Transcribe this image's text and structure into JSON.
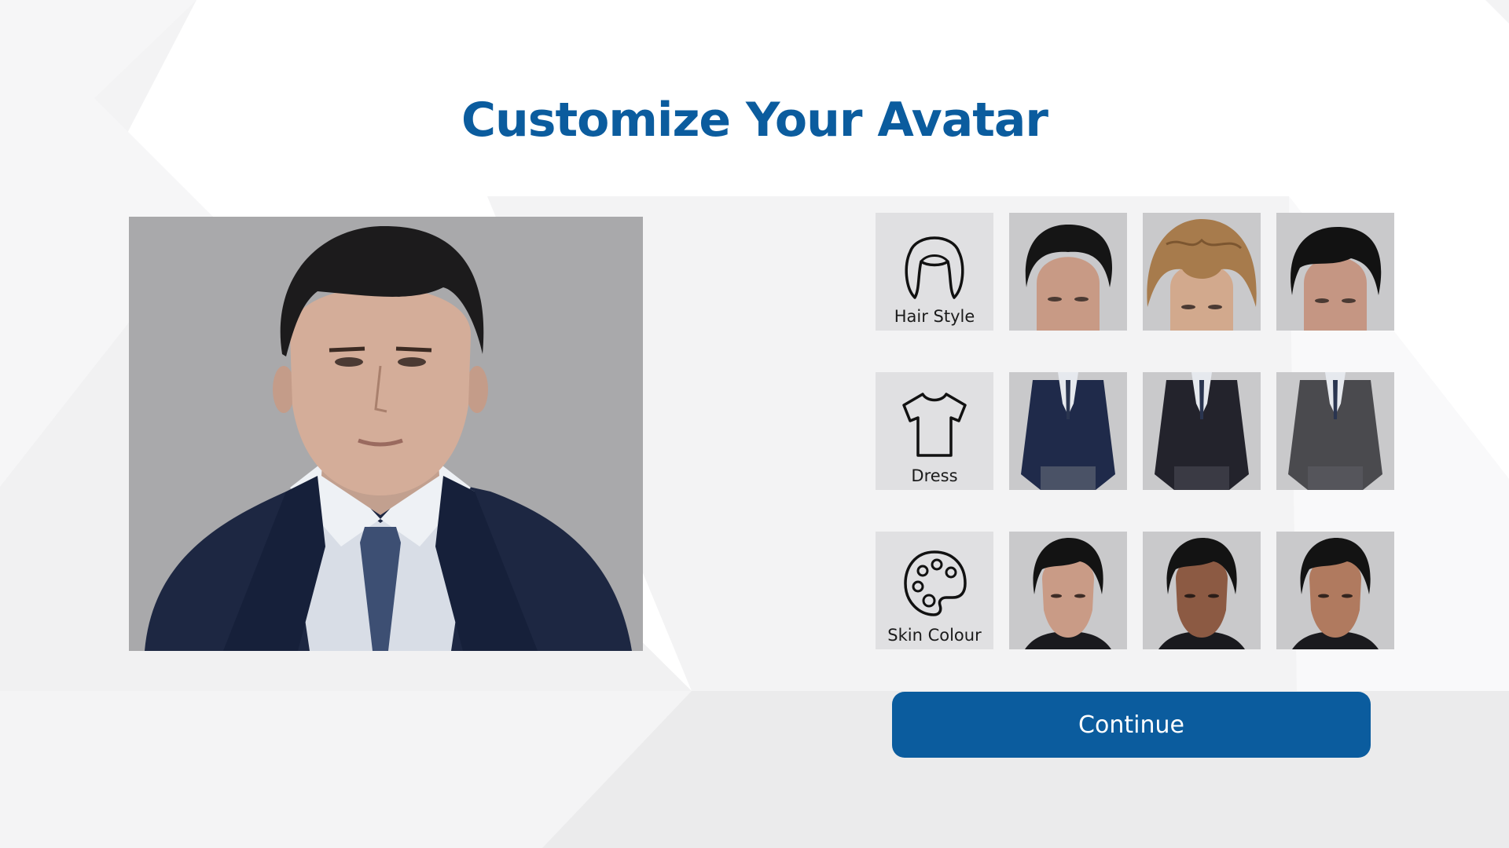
{
  "page": {
    "title": "Customize Your Avatar",
    "accent_color": "#0b5c9e",
    "background_color": "#f4f4f5"
  },
  "preview": {
    "background_color": "#a9a9ab",
    "hair_color": "#1c1b1c",
    "suit_color": "#1d2742",
    "shirt_color": "#d8dde6",
    "tie_color": "#3d4f73"
  },
  "categories": [
    {
      "label": "Hair Style",
      "icon": "hair-icon",
      "options": [
        {
          "hair_color": "#151515",
          "skin_color": "#c89a85",
          "type": "short-dark"
        },
        {
          "hair_color": "#a77b4c",
          "skin_color": "#d2a98d",
          "type": "wavy-blonde"
        },
        {
          "hair_color": "#121212",
          "skin_color": "#c59683",
          "type": "swept-dark"
        }
      ]
    },
    {
      "label": "Dress",
      "icon": "tshirt-icon",
      "options": [
        {
          "suit_color": "#1f2a4a",
          "type": "navy-suit"
        },
        {
          "suit_color": "#23232c",
          "type": "black-suit"
        },
        {
          "suit_color": "#4a4a4e",
          "type": "grey-suit"
        }
      ]
    },
    {
      "label": "Skin Colour",
      "icon": "palette-icon",
      "options": [
        {
          "skin_color": "#c99b86",
          "type": "light",
          "selected": true
        },
        {
          "skin_color": "#8c5a43",
          "type": "dark"
        },
        {
          "skin_color": "#b07a5f",
          "type": "medium"
        }
      ]
    }
  ],
  "continue_label": "Continue"
}
